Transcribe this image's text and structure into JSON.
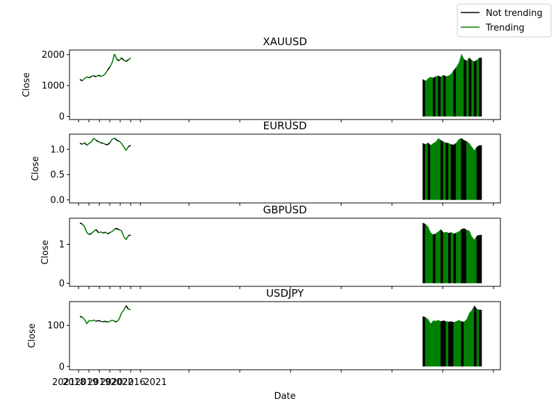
{
  "chart_data": {
    "type": "line",
    "xlabel": "Date",
    "ylabel": "Close",
    "x_tick_labels_visible": [
      "2021",
      "2018",
      "2019",
      "2019",
      "2020",
      "2022",
      "2016",
      "2021"
    ],
    "series_styles": [
      {
        "name": "Not trending",
        "color": "#000000"
      },
      {
        "name": "Trending",
        "color": "#008000"
      }
    ],
    "legend": {
      "placement": "top-right"
    },
    "panels": [
      {
        "title": "XAUUSD",
        "yticks": [
          0,
          1000,
          2000
        ],
        "ylim": [
          -100,
          2150
        ],
        "close": [
          1200,
          1150,
          1230,
          1280,
          1250,
          1300,
          1320,
          1280,
          1340,
          1300,
          1320,
          1380,
          1500,
          1600,
          1750,
          2020,
          1850,
          1800,
          1900,
          1820,
          1780,
          1830,
          1900
        ],
        "trend": [
          0,
          1,
          1,
          1,
          0,
          1,
          0,
          1,
          0,
          1,
          1,
          1,
          0,
          1,
          1,
          1,
          0,
          1,
          0,
          1,
          0,
          1,
          0
        ]
      },
      {
        "title": "EURUSD",
        "yticks": [
          0.0,
          0.5,
          1.0
        ],
        "yticklabels": [
          "0.0",
          "0.5",
          "1.0"
        ],
        "ylim": [
          -0.06,
          1.3
        ],
        "close": [
          1.12,
          1.1,
          1.13,
          1.08,
          1.12,
          1.15,
          1.22,
          1.18,
          1.15,
          1.13,
          1.12,
          1.1,
          1.09,
          1.13,
          1.2,
          1.22,
          1.18,
          1.16,
          1.12,
          1.05,
          0.98,
          1.05,
          1.08
        ],
        "trend": [
          0,
          1,
          0,
          1,
          1,
          1,
          1,
          0,
          1,
          0,
          1,
          0,
          0,
          1,
          1,
          0,
          0,
          1,
          1,
          1,
          1,
          0,
          0
        ]
      },
      {
        "title": "GBPUSD",
        "yticks": [
          0,
          1
        ],
        "ylim": [
          -0.08,
          1.67
        ],
        "close": [
          1.55,
          1.52,
          1.45,
          1.3,
          1.25,
          1.28,
          1.33,
          1.38,
          1.3,
          1.32,
          1.29,
          1.31,
          1.27,
          1.3,
          1.33,
          1.39,
          1.41,
          1.37,
          1.35,
          1.2,
          1.12,
          1.22,
          1.24
        ],
        "trend": [
          0,
          1,
          1,
          1,
          0,
          1,
          1,
          0,
          1,
          1,
          0,
          1,
          0,
          1,
          1,
          0,
          0,
          1,
          1,
          1,
          1,
          0,
          0
        ]
      },
      {
        "title": "USDJPY",
        "yticks": [
          0,
          100
        ],
        "ylim": [
          -8,
          158
        ],
        "close": [
          122,
          120,
          115,
          104,
          112,
          111,
          113,
          110,
          112,
          110,
          109,
          110,
          108,
          110,
          113,
          110,
          109,
          115,
          130,
          137,
          148,
          140,
          138
        ],
        "trend": [
          0,
          1,
          1,
          1,
          1,
          1,
          1,
          0,
          0,
          1,
          0,
          0,
          1,
          1,
          1,
          0,
          1,
          1,
          1,
          1,
          0,
          1,
          0
        ]
      }
    ]
  }
}
